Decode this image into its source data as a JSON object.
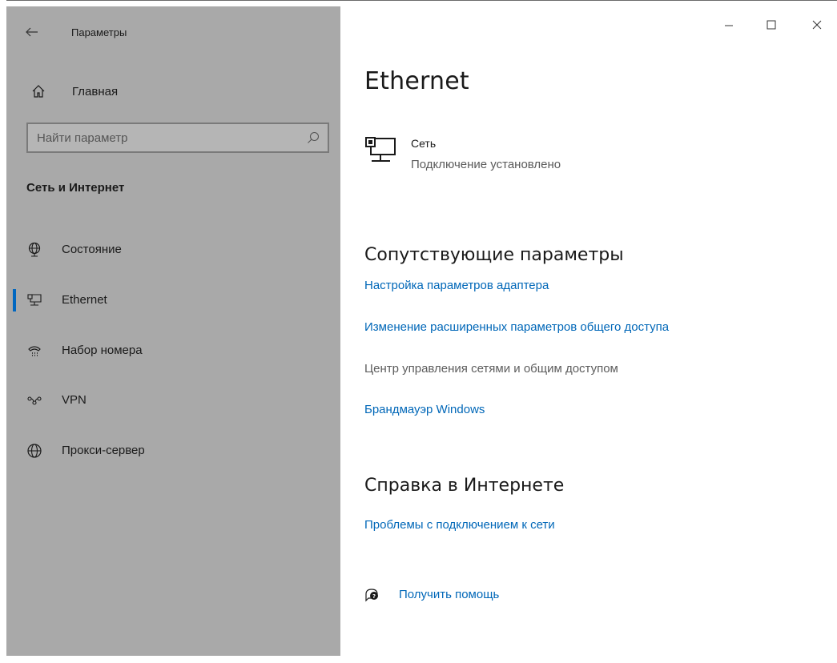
{
  "window": {
    "title": "Параметры",
    "minimize_icon": "minimize-icon",
    "maximize_icon": "maximize-icon",
    "close_icon": "close-icon"
  },
  "sidebar": {
    "home_label": "Главная",
    "search_placeholder": "Найти параметр",
    "section_title": "Сеть и Интернет",
    "items": [
      {
        "label": "Состояние",
        "icon": "globe-status-icon",
        "selected": false
      },
      {
        "label": "Ethernet",
        "icon": "ethernet-icon",
        "selected": true
      },
      {
        "label": "Набор номера",
        "icon": "dialup-icon",
        "selected": false
      },
      {
        "label": "VPN",
        "icon": "vpn-icon",
        "selected": false
      },
      {
        "label": "Прокси-сервер",
        "icon": "globe-icon",
        "selected": false
      }
    ],
    "accent_color": "#0067c0",
    "background": "#a9a9a9"
  },
  "main": {
    "title": "Ethernet",
    "network": {
      "name": "Сеть",
      "status": "Подключение установлено",
      "icon": "network-computer-icon"
    },
    "related": {
      "heading": "Сопутствующие параметры",
      "links": [
        {
          "label": "Настройка параметров адаптера",
          "enabled": true
        },
        {
          "label": "Изменение расширенных параметров общего доступа",
          "enabled": true
        },
        {
          "label": "Центр управления сетями и общим доступом",
          "enabled": false
        },
        {
          "label": "Брандмауэр Windows",
          "enabled": true
        }
      ]
    },
    "online_help": {
      "heading": "Справка в Интернете",
      "links": [
        {
          "label": "Проблемы с подключением к сети"
        }
      ]
    },
    "get_help": {
      "label": "Получить помощь",
      "icon": "help-chat-icon"
    },
    "link_color": "#0067b8"
  }
}
